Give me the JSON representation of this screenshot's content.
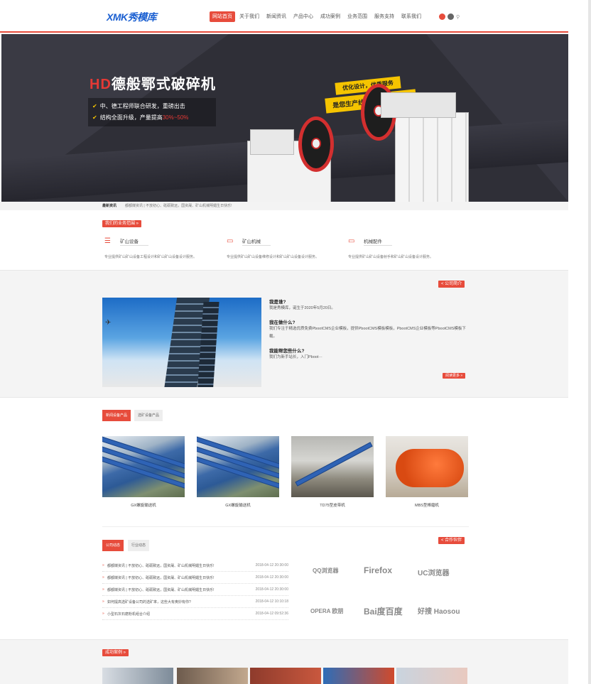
{
  "header": {
    "logo_a": "XMK",
    "logo_b": "秀模库",
    "nav": [
      "网站首页",
      "关于我们",
      "新闻资讯",
      "产品中心",
      "成功案例",
      "业务范围",
      "服务支持",
      "联系我们"
    ],
    "search_icon": "search-icon"
  },
  "banner": {
    "title_hd": "HD",
    "title_rest": "德般鄂式破碎机",
    "bullet1": "中、德工程师联合研发，重磅出击",
    "bullet2_a": "结构全面升级，产量提高",
    "bullet2_b": "30%~50%",
    "ribbon1": "优化设计，优质服务",
    "ribbon2": "是您生产线高产稳定的基础"
  },
  "newsbar": {
    "label": "最新资讯",
    "text": "都都媒资讯 | 不放初心、砥砺致远，国资晟、矿山机械明媚生日快乐!"
  },
  "business": {
    "tag": "我们的业务范围 »",
    "items": [
      {
        "title": "矿山设备",
        "desc": "专业提供矿山矿山设备工程设计和矿山矿山设备设计服务。"
      },
      {
        "title": "矿山机械",
        "desc": "专业提供矿山矿山设备维修设计和矿山矿山设备设计服务。"
      },
      {
        "title": "机械配件",
        "desc": "专业提供矿山矿山设备射手和矿山矿山设备设计服务。"
      }
    ]
  },
  "about": {
    "tag": "< 公司简介",
    "q1": "我是谁?",
    "a1": "我是秀模库，诞生于2020年5月20日。",
    "q2": "我在做什么?",
    "a2": "我们专注于精选优质免费PbootCMS企业模板，提供PbootCMS模板模板，PbootCMS企业模板等PbootCMS模板下载。",
    "q3": "我能帮您些什么?",
    "a3": "我们为新手站长，入门Pboot···",
    "more": "阅读更多 »"
  },
  "products": {
    "tab_on": "新闻设备产品",
    "tab_off": "选矿设备产品",
    "items": [
      {
        "name": "GX螺旋输送机"
      },
      {
        "name": "GX螺旋输送机"
      },
      {
        "name": "TD75型皮带机"
      },
      {
        "name": "MBS型棒磨机"
      }
    ]
  },
  "news": {
    "tab_on": "公司动态",
    "tab_off": "行业动态",
    "partner_tag": "< 合作伙伴",
    "rows": [
      {
        "title": "都都媒资讯 | 不放初心、砥砺致远，国资晟、矿山机械明媚生日快乐!",
        "date": "2018-04-12 20:30:00"
      },
      {
        "title": "都都媒资讯 | 不放初心、砥砺致远，国资晟、矿山机械明媚生日快乐!",
        "date": "2018-04-12 20:30:00"
      },
      {
        "title": "都都媒资讯 | 不放初心、砥砺致远，国资晟、矿山机械明媚生日快乐!",
        "date": "2018-04-12 20:30:00"
      },
      {
        "title": "如何提高选矿设备公司的选矿率，这些大有奥妙有你?",
        "date": "2018-04-12 10:10:18"
      },
      {
        "title": "小型石灰石磨粉机组合介绍",
        "date": "2018-04-12 09:52:36"
      }
    ],
    "partners": [
      "QQ浏览器",
      "Firefox",
      "UC浏览器",
      "OPERA 欧朋",
      "Bai度百度",
      "好搜 Haosou"
    ]
  },
  "cases": {
    "tag": "成功案例 »"
  },
  "colors": {
    "accent": "#e74c3c",
    "logo": "#1a5fd1",
    "banner_bg": "#2f2f37",
    "highlight": "#f5c400"
  }
}
